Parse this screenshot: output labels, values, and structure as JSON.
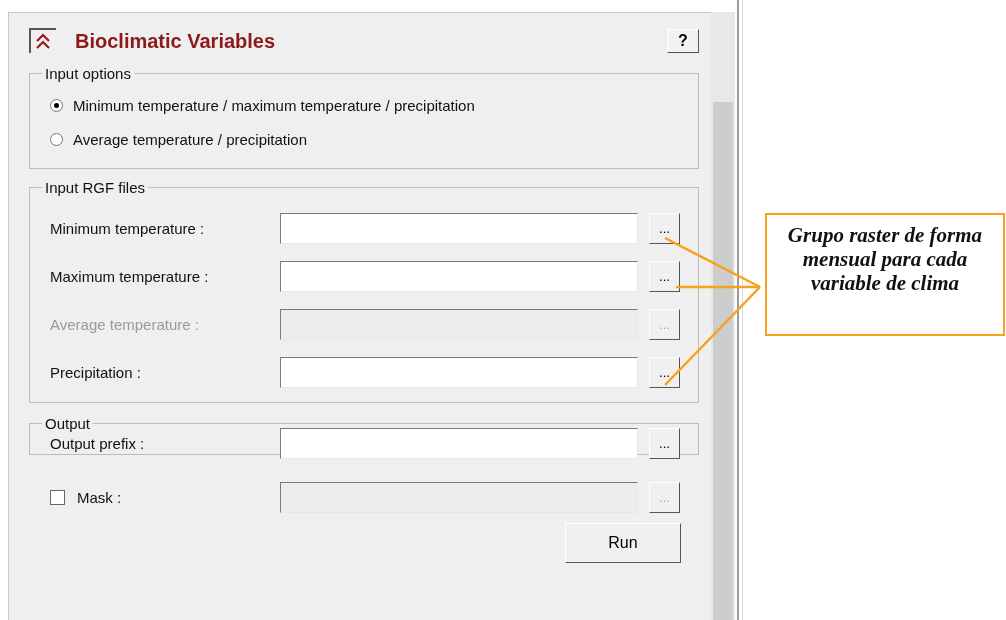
{
  "panel": {
    "title": "Bioclimatic Variables",
    "help": "?"
  },
  "input_options": {
    "title": "Input options",
    "options": [
      {
        "label": "Minimum temperature / maximum temperature / precipitation",
        "selected": true
      },
      {
        "label": "Average temperature / precipitation",
        "selected": false
      }
    ]
  },
  "input_files": {
    "title": "Input RGF files",
    "rows": [
      {
        "label": "Minimum temperature :",
        "disabled": false,
        "browse": "..."
      },
      {
        "label": "Maximum temperature :",
        "disabled": false,
        "browse": "..."
      },
      {
        "label": "Average temperature :",
        "disabled": true,
        "browse": "..."
      },
      {
        "label": "Precipitation :",
        "disabled": false,
        "browse": "..."
      }
    ]
  },
  "output": {
    "title": "Output",
    "rows": [
      {
        "label": "Output prefix :",
        "disabled": false,
        "browse": "..."
      }
    ]
  },
  "mask": {
    "label": "Mask :",
    "checked": false,
    "disabled": true,
    "browse": "..."
  },
  "run_button": "Run",
  "callout": {
    "text": "Grupo raster de forma mensual para cada variable de clima"
  }
}
